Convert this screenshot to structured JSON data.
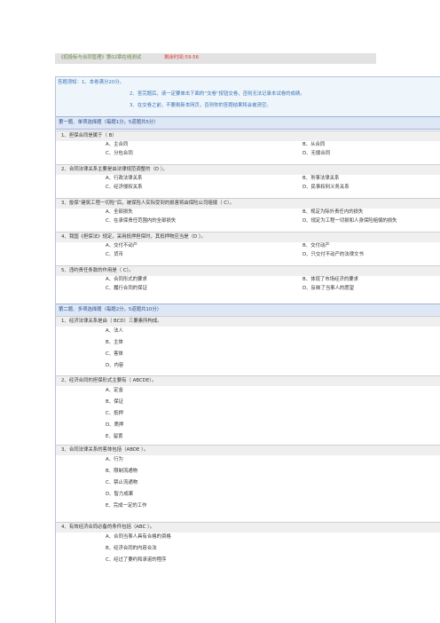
{
  "header": {
    "title": "《招投标与合同管理》第02章在线测试",
    "timer_label": "剩余时间:",
    "timer_value": "59:56"
  },
  "notice": {
    "line1": "答题须知：1、本卷满分20分。",
    "line2": "2、答完题后，请一定要单击下面的“交卷”按钮交卷，否则无法记录本试卷的成绩。",
    "line3": "3、在交卷之前，不要刷新本网页，否则你的答题结果将会被清空。"
  },
  "sections": [
    {
      "title": "第一题、单项选择题（每题1分，5道题共5分）",
      "questions": [
        {
          "text": "1、担保合同是属于（ B）",
          "options": [
            "A、主合同",
            "B、从合同",
            "C、分包合同",
            "D、无偿合同"
          ]
        },
        {
          "text": "2、合同法律关系主要是由法律规范调整的（D ）。",
          "options": [
            "A、行政法律关系",
            "B、刑事法律关系",
            "C、经济侵权关系",
            "D、民事权利义务关系"
          ]
        },
        {
          "text": "3、投保“建筑工程一切险”后，被保险人实际受到的损害将由保险公司赔偿（ C）。",
          "options": [
            "A、全部损失",
            "B、规定为除外责任内的损失",
            "C、在承保责任范围内的全部损失",
            "D、规定为工程一切损和人身保险赔偿的损失"
          ]
        },
        {
          "text": "4、我国《担保法》规定，采用抵押担保时，其抵押物应当是（D ）。",
          "options": [
            "A、交付不动产",
            "B、交付动产",
            "C、货币",
            "D、只交付不动产的法律文书"
          ]
        },
        {
          "text": "5、违约责任条款的作用是（ C）。",
          "options": [
            "A、合同形式的要求",
            "B、体现了市场经济的要求",
            "C、履行合同的保证",
            "D、反映了当事人的愿望"
          ]
        }
      ]
    },
    {
      "title": "第二题、多项选择题（每题2分，5道题共10分）",
      "questions": [
        {
          "text": "1、经济法律关系是由（ BCD）三要素所构成。",
          "options": [
            "A、法人",
            "B、主体",
            "C、客体",
            "D、内容"
          ]
        },
        {
          "text": "2、经济合同的担保形式主要有（ ABCDE）。",
          "options": [
            "A、定金",
            "B、保证",
            "C、抵押",
            "D、质押",
            "E、留置"
          ]
        },
        {
          "text": "3、合同法律关系的客体包括（ABDE ）。",
          "options": [
            "A、行为",
            "B、限制流通物",
            "C、禁止流通物",
            "D、智力成果",
            "E、完成一定的工作"
          ]
        },
        {
          "text": "4、有效经济合同必备的条件包括（ABC ）。",
          "options": [
            "A、合同当事人具有合格的资格",
            "B、经济合同的内容合法",
            "C、经过了要约和承诺的程序"
          ]
        }
      ]
    }
  ]
}
